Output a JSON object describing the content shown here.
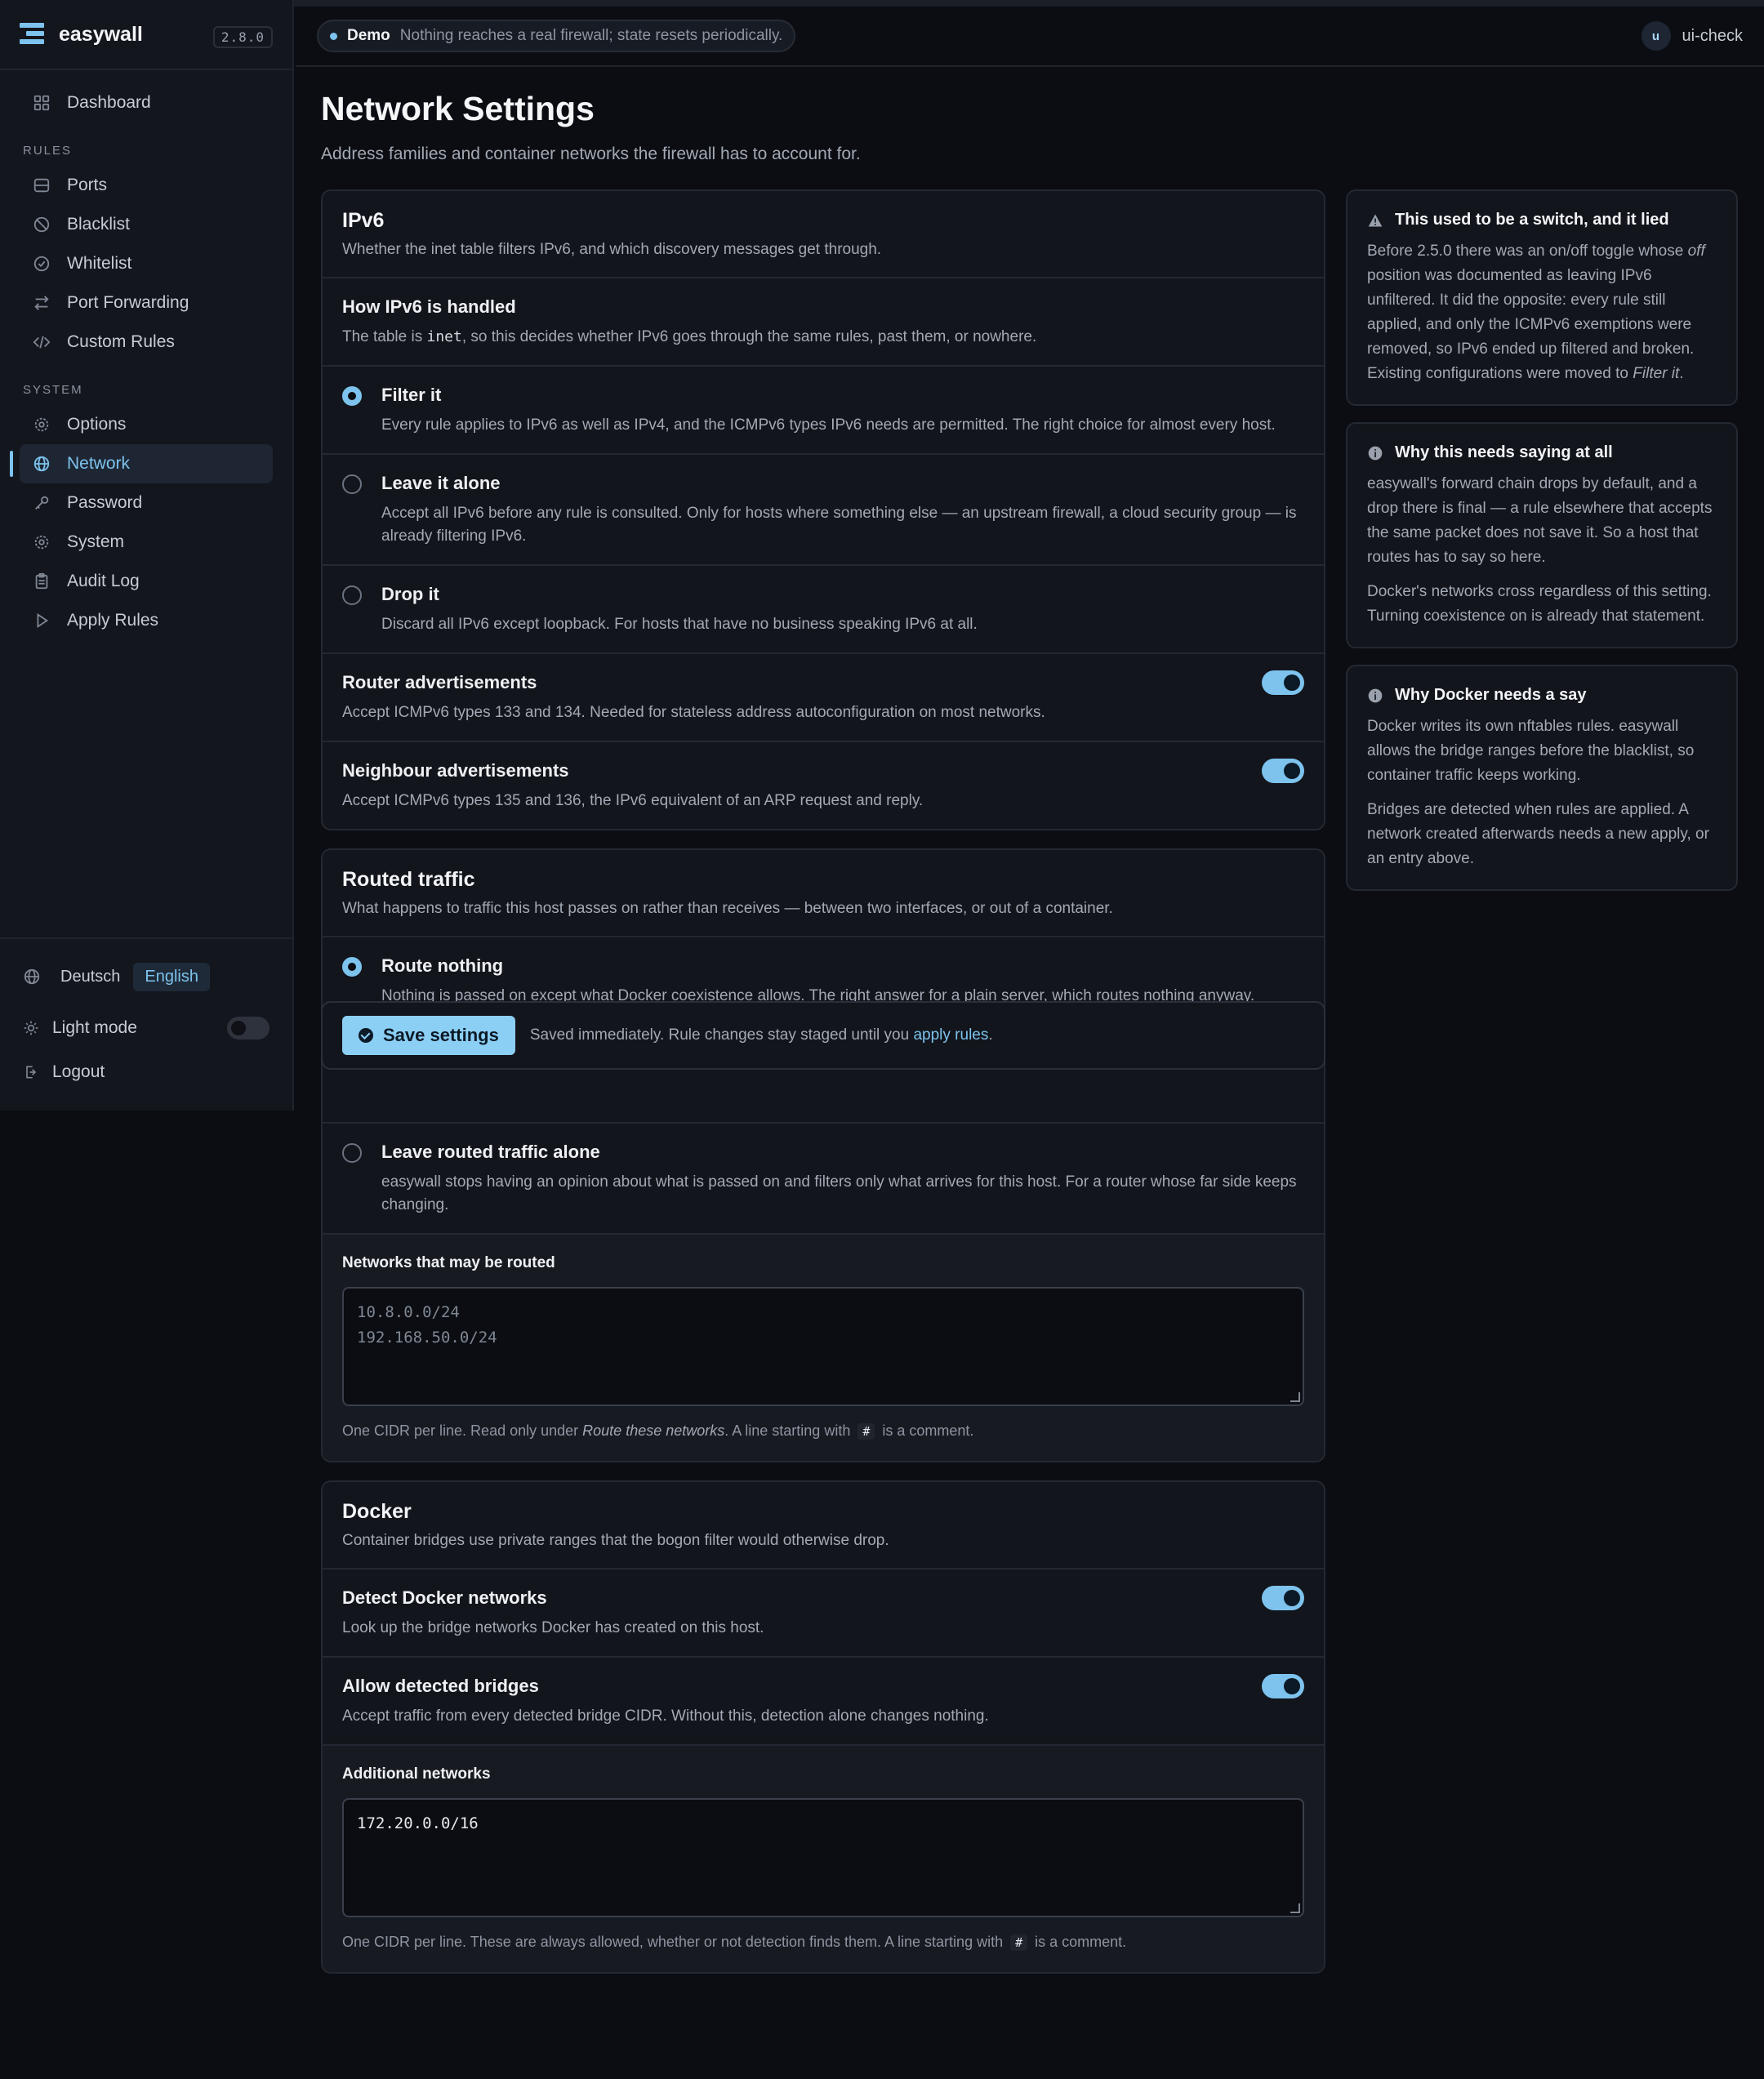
{
  "app": {
    "name": "easywall",
    "version": "2.8.0"
  },
  "topbar": {
    "demo_label": "Demo",
    "demo_text": "Nothing reaches a real firewall; state resets periodically.",
    "user_initial": "u",
    "user_name": "ui-check"
  },
  "sidebar": {
    "dashboard": "Dashboard",
    "rules_section": "RULES",
    "rules": [
      "Ports",
      "Blacklist",
      "Whitelist",
      "Port Forwarding",
      "Custom Rules"
    ],
    "system_section": "SYSTEM",
    "system": [
      "Options",
      "Network",
      "Password",
      "System",
      "Audit Log",
      "Apply Rules"
    ],
    "active": "Network",
    "lang_de": "Deutsch",
    "lang_en": "English",
    "light_mode": "Light mode",
    "logout": "Logout"
  },
  "page": {
    "title": "Network Settings",
    "subtitle": "Address families and container networks the firewall has to account for."
  },
  "ipv6": {
    "title": "IPv6",
    "desc": "Whether the inet table filters IPv6, and which discovery messages get through.",
    "handling_title": "How IPv6 is handled",
    "handling_desc_pre": "The table is ",
    "handling_desc_code": "inet",
    "handling_desc_post": ", so this decides whether IPv6 goes through the same rules, past them, or nowhere.",
    "options": [
      {
        "title": "Filter it",
        "desc": "Every rule applies to IPv6 as well as IPv4, and the ICMPv6 types IPv6 needs are permitted. The right choice for almost every host.",
        "selected": true
      },
      {
        "title": "Leave it alone",
        "desc": "Accept all IPv6 before any rule is consulted. Only for hosts where something else — an upstream firewall, a cloud security group — is already filtering IPv6.",
        "selected": false
      },
      {
        "title": "Drop it",
        "desc": "Discard all IPv6 except loopback. For hosts that have no business speaking IPv6 at all.",
        "selected": false
      }
    ],
    "router_adv_title": "Router advertisements",
    "router_adv_desc": "Accept ICMPv6 types 133 and 134. Needed for stateless address autoconfiguration on most networks.",
    "router_adv_on": true,
    "neigh_adv_title": "Neighbour advertisements",
    "neigh_adv_desc": "Accept ICMPv6 types 135 and 136, the IPv6 equivalent of an ARP request and reply.",
    "neigh_adv_on": true
  },
  "routed": {
    "title": "Routed traffic",
    "desc": "What happens to traffic this host passes on rather than receives — between two interfaces, or out of a container.",
    "opt1_title": "Route nothing",
    "opt1_desc": "Nothing is passed on except what Docker coexistence allows. The right answer for a plain server, which routes nothing anyway.",
    "opt3_title": "Leave routed traffic alone",
    "opt3_desc": "easywall stops having an opinion about what is passed on and filters only what arrives for this host. For a router whose far side keeps changing.",
    "networks_label": "Networks that may be routed",
    "networks_placeholder": "10.8.0.0/24\n192.168.50.0/24",
    "hint_pre": "One CIDR per line. Read only under ",
    "hint_em": "Route these networks",
    "hint_mid": ". A line starting with ",
    "hint_kbd": "#",
    "hint_post": " is a comment."
  },
  "save": {
    "button": "Save settings",
    "note_pre": "Saved immediately. Rule changes stay staged until you ",
    "note_link": "apply rules",
    "note_post": "."
  },
  "docker": {
    "title": "Docker",
    "desc": "Container bridges use private ranges that the bogon filter would otherwise drop.",
    "detect_title": "Detect Docker networks",
    "detect_desc": "Look up the bridge networks Docker has created on this host.",
    "detect_on": true,
    "allow_title": "Allow detected bridges",
    "allow_desc": "Accept traffic from every detected bridge CIDR. Without this, detection alone changes nothing.",
    "allow_on": true,
    "additional_label": "Additional networks",
    "additional_value": "172.20.0.0/16",
    "hint_pre": "One CIDR per line. These are always allowed, whether or not detection finds them. A line starting with ",
    "hint_kbd": "#",
    "hint_post": " is a comment."
  },
  "info": [
    {
      "icon": "warning-icon",
      "title": "This used to be a switch, and it lied",
      "p1_a": "Before 2.5.0 there was an on/off toggle whose ",
      "p1_em": "off",
      "p1_b": " position was documented as leaving IPv6 unfiltered. It did the opposite: every rule still applied, and only the ICMPv6 exemptions were removed, so IPv6 ended up filtered and broken. Existing configurations were moved to ",
      "p1_em2": "Filter it",
      "p1_c": "."
    },
    {
      "icon": "info-icon",
      "title": "Why this needs saying at all",
      "p1": "easywall's forward chain drops by default, and a drop there is final — a rule elsewhere that accepts the same packet does not save it. So a host that routes has to say so here.",
      "p2": "Docker's networks cross regardless of this setting. Turning coexistence on is already that statement."
    },
    {
      "icon": "info-icon",
      "title": "Why Docker needs a say",
      "p1": "Docker writes its own nftables rules. easywall allows the bridge ranges before the blacklist, so container traffic keeps working.",
      "p2": "Bridges are detected when rules are applied. A network created afterwards needs a new apply, or an entry above."
    }
  ],
  "colors": {
    "accent": "#7dc3ee",
    "background": "#0b0d12",
    "surface": "#12151b"
  }
}
